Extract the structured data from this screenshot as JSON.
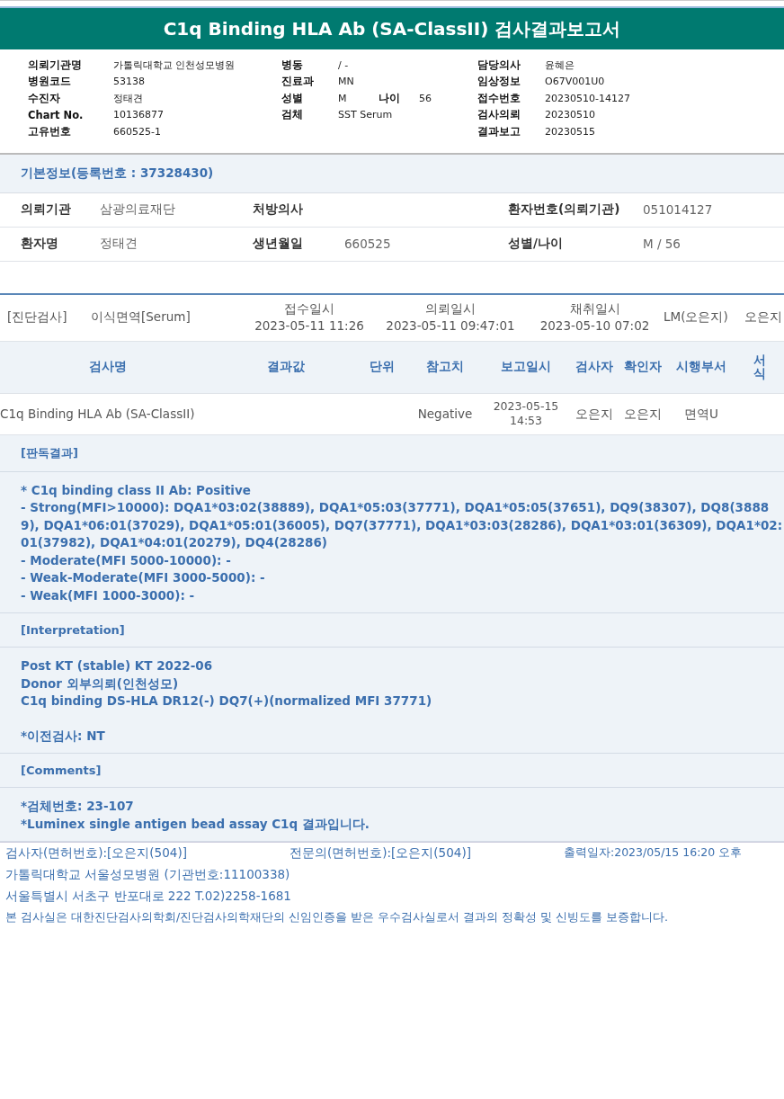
{
  "title": "C1q Binding HLA Ab (SA-ClassII) 검사결과보고서",
  "header_columns": [
    [
      {
        "fields": [
          {
            "label": "의뢰기관명",
            "value": "가톨릭대학교 인천성모병원"
          }
        ]
      },
      {
        "fields": [
          {
            "label": "병원코드",
            "value": "53138"
          }
        ]
      },
      {
        "fields": [
          {
            "label": "수진자",
            "value": "정태견"
          }
        ]
      },
      {
        "fields": [
          {
            "label": "Chart No.",
            "value": "10136877"
          }
        ]
      },
      {
        "fields": [
          {
            "label": "고유번호",
            "value": "660525-1"
          }
        ]
      }
    ],
    [
      {
        "fields": [
          {
            "label": "병동",
            "value": "/ -"
          }
        ]
      },
      {
        "fields": [
          {
            "label": "진료과",
            "value": "MN"
          }
        ]
      },
      {
        "fields": [
          {
            "label": "성별",
            "value": "M"
          },
          {
            "label": "나이",
            "value": "56"
          }
        ]
      },
      {
        "fields": [
          {
            "label": "검체",
            "value": "SST Serum"
          }
        ]
      }
    ],
    [
      {
        "fields": [
          {
            "label": "담당의사",
            "value": "윤혜은"
          }
        ]
      },
      {
        "fields": [
          {
            "label": "임상정보",
            "value": "O67V001U0"
          }
        ]
      },
      {
        "fields": [
          {
            "label": "접수번호",
            "value": "20230510-14127"
          }
        ]
      },
      {
        "fields": [
          {
            "label": "검사의뢰",
            "value": "20230510"
          }
        ]
      },
      {
        "fields": [
          {
            "label": "결과보고",
            "value": "20230515"
          }
        ]
      }
    ]
  ],
  "basic_info": {
    "title": "기본정보(등록번호 : 37328430)",
    "rows": [
      [
        {
          "label": "의뢰기관",
          "value": "삼광의료재단"
        },
        {
          "label": "처방의사"
        },
        {
          "label": "환자번호(의뢰기관)",
          "value": "051014127"
        }
      ],
      [
        {
          "label": "환자명",
          "value": "정태견"
        },
        {
          "label": "생년월일",
          "value": "660525"
        },
        {
          "label": "성별/나이",
          "value": "M / 56"
        }
      ]
    ]
  },
  "order": {
    "category": "[진단검사]",
    "department": "이식면역[Serum]",
    "dates": [
      {
        "label": "접수일시",
        "value": "2023-05-11 11:26"
      },
      {
        "label": "의뢰일시",
        "value": "2023-05-11 09:47:01"
      },
      {
        "label": "채취일시",
        "value": "2023-05-10 07:02"
      }
    ],
    "lab": "LM(오은지)",
    "staff": "오은지"
  },
  "table": {
    "columns": [
      "검사명",
      "결과값",
      "단위",
      "참고치",
      "보고일시",
      "검사자",
      "확인자",
      "시행부서",
      "서식"
    ],
    "rows": [
      {
        "test": "C1q Binding HLA Ab (SA-ClassII)",
        "reference": "Negative",
        "report_date": "2023-05-15",
        "report_time": "14:53",
        "tester": "오은지",
        "verifier": "오은지",
        "department": "면역U"
      }
    ]
  },
  "sections": [
    {
      "heading": "[판독결과]",
      "paragraphs": [
        [
          "* C1q binding class II Ab: Positive",
          "- Strong(MFI>10000): DQA1*03:02(38889), DQA1*05:03(37771), DQA1*05:05(37651), DQ9(38307), DQ8(38889), DQA1*06:01(37029), DQA1*05:01(36005), DQ7(37771), DQA1*03:03(28286), DQA1*03:01(36309), DQA1*02:01(37982), DQA1*04:01(20279), DQ4(28286)",
          "- Moderate(MFI 5000-10000): -",
          "- Weak-Moderate(MFI 3000-5000): -",
          "- Weak(MFI 1000-3000): -"
        ]
      ]
    },
    {
      "heading": "[Interpretation]",
      "paragraphs": [
        [
          "Post KT (stable) KT 2022-06",
          "Donor 외부의뢰(인천성모)",
          "C1q binding DS-HLA DR12(-) DQ7(+)(normalized MFI 37771)"
        ],
        [
          "*이전검사: NT"
        ]
      ]
    },
    {
      "heading": "[Comments]",
      "paragraphs": [
        [
          "*검체번호: 23-107",
          "*Luminex single antigen bead assay C1q 결과입니다."
        ]
      ]
    }
  ],
  "footer": {
    "signatures": [
      "검사자(면허번호):[오은지(504)]",
      "전문의(면허번호):[오은지(504)]",
      "출력일자:2023/05/15 16:20 오후"
    ],
    "lines": [
      "가톨릭대학교 서울성모병원 (기관번호:11100338)",
      "서울특별시 서초구 반포대로 222 T.02)2258-1681",
      "본 검사실은 대한진단검사의학회/진단검사의학재단의 신임인증을 받은 우수검사실로서 결과의 정확성 및 신빙도를 보증합니다."
    ]
  }
}
